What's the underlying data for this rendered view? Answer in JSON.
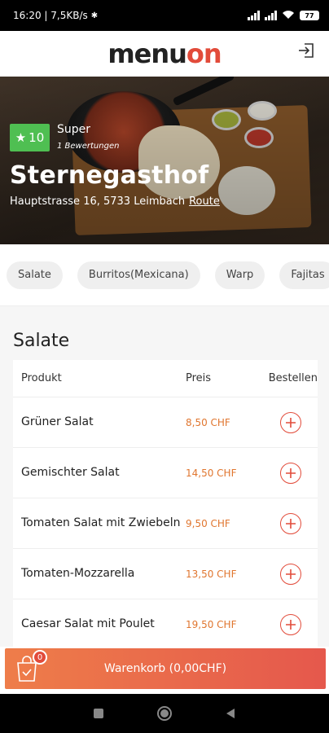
{
  "statusbar": {
    "time_speed": "16:20 | 7,5KB/s",
    "battery": "77"
  },
  "header": {
    "logo_main": "menu",
    "logo_accent": "on"
  },
  "restaurant": {
    "rating_score": "10",
    "rating_word": "Super",
    "rating_count": "1 Bewertungen",
    "name": "Sternegasthof",
    "address": "Hauptstrasse 16, 5733 Leimbach",
    "route_label": "Route"
  },
  "categories": [
    "Salate",
    "Burritos(Mexicana)",
    "Warp",
    "Fajitas"
  ],
  "section": {
    "title": "Salate",
    "columns": {
      "product": "Produkt",
      "price": "Preis",
      "order": "Bestellen"
    },
    "items": [
      {
        "name": "Grüner Salat",
        "price": "8,50 CHF"
      },
      {
        "name": "Gemischter Salat",
        "price": "14,50 CHF"
      },
      {
        "name": "Tomaten Salat mit Zwiebeln",
        "price": "9,50 CHF"
      },
      {
        "name": "Tomaten-Mozzarella",
        "price": "13,50 CHF"
      },
      {
        "name": "Caesar Salat mit Poulet",
        "price": "19,50 CHF"
      }
    ]
  },
  "cart": {
    "count": "0",
    "label": "Warenkorb (0,00CHF)"
  },
  "colors": {
    "accent": "#e24b3a",
    "price": "#e0762f",
    "rating": "#4fbf52"
  }
}
